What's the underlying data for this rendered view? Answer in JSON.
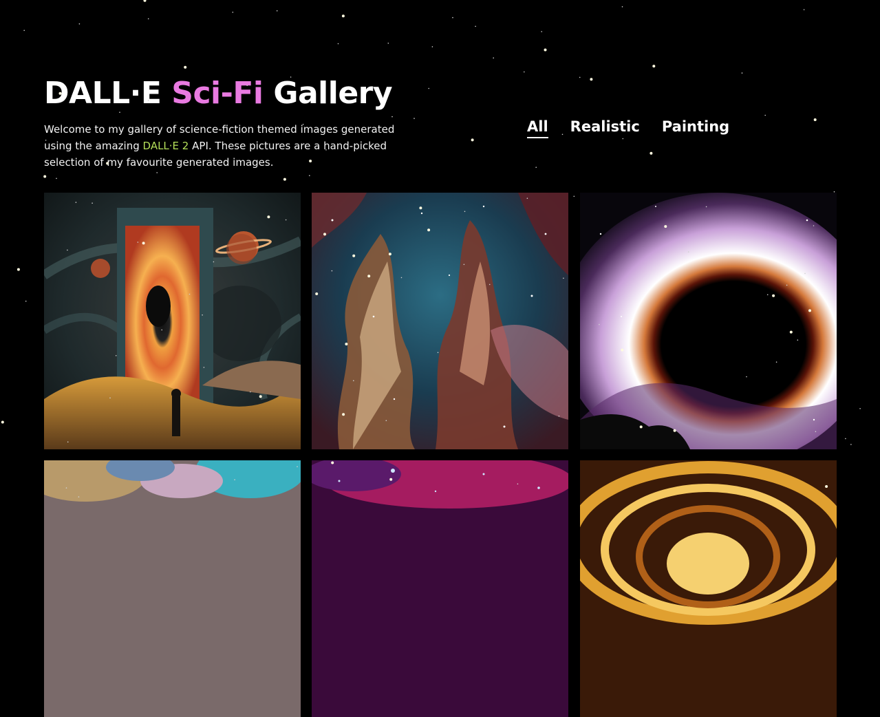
{
  "header": {
    "title_part1": "DALL·E",
    "title_part2": "Sci-Fi",
    "title_part3": "Gallery",
    "intro_part1": "Welcome to my gallery of science-fiction themed images generated using the amazing",
    "intro_link": "DALL·E 2",
    "intro_part2": "API. These pictures are a hand-picked selection of my favourite generated images."
  },
  "filters": [
    {
      "label": "All",
      "active": true
    },
    {
      "label": "Realistic",
      "active": false
    },
    {
      "label": "Painting",
      "active": false
    }
  ],
  "gallery": {
    "images": [
      {
        "subject": "portal-painting"
      },
      {
        "subject": "nebula-pillars"
      },
      {
        "subject": "black-hole"
      },
      {
        "subject": "colorful-nebula-painting"
      },
      {
        "subject": "pink-star-field"
      },
      {
        "subject": "golden-vortex"
      }
    ]
  },
  "colors": {
    "background": "#000000",
    "title_accent": "#e97ae1",
    "link": "#b5e05a",
    "text": "#ffffff"
  }
}
